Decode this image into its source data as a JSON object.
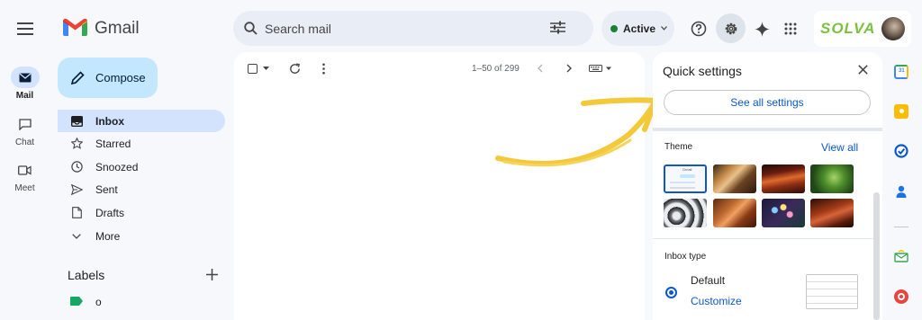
{
  "app": {
    "name": "Gmail"
  },
  "rail": {
    "mail": "Mail",
    "chat": "Chat",
    "meet": "Meet"
  },
  "header": {
    "search_placeholder": "Search mail",
    "status": "Active",
    "brand": "SOLVA"
  },
  "compose_label": "Compose",
  "nav": [
    {
      "label": "Inbox",
      "icon": "inbox-icon"
    },
    {
      "label": "Starred",
      "icon": "star-icon"
    },
    {
      "label": "Snoozed",
      "icon": "clock-icon"
    },
    {
      "label": "Sent",
      "icon": "send-icon"
    },
    {
      "label": "Drafts",
      "icon": "draft-icon"
    },
    {
      "label": "More",
      "icon": "chevron-down-icon"
    }
  ],
  "labels": {
    "title": "Labels",
    "items": [
      {
        "name": "o"
      }
    ]
  },
  "toolbar": {
    "pagination": "1–50 of 299"
  },
  "quick_settings": {
    "title": "Quick settings",
    "see_all": "See all settings",
    "theme": "Theme",
    "view_all": "View all",
    "inbox_type": "Inbox type",
    "default": "Default",
    "customize": "Customize",
    "theme_thumb_text": "Gmail"
  },
  "colors": {
    "accent": "#0b57d0",
    "compose_bg": "#c2e7ff",
    "nav_active": "#d3e3fd",
    "status_dot": "#188038",
    "brand_green": "#7cc242"
  }
}
